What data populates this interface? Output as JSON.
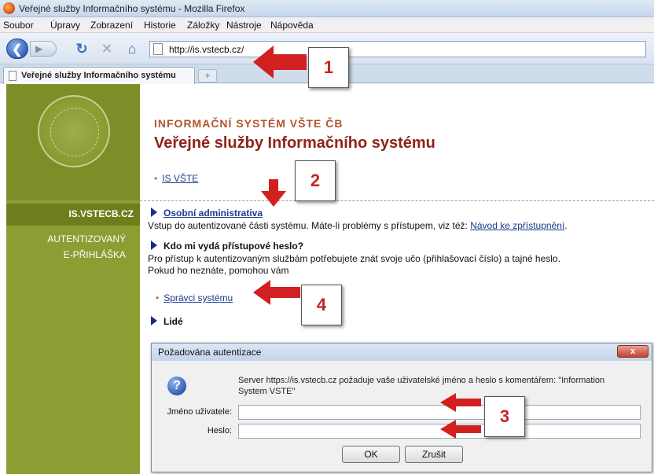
{
  "window": {
    "title": "Veřejné služby Informačního systému - Mozilla Firefox"
  },
  "menu": {
    "items": [
      "Soubor",
      "Úpravy",
      "Zobrazení",
      "Historie",
      "Záložky",
      "Nástroje",
      "Nápověda"
    ]
  },
  "toolbar": {
    "url": "http://is.vstecb.cz/"
  },
  "tabs": {
    "active_label": "Veřejné služby Informačního systému",
    "new_tab_label": "+"
  },
  "sidebar": {
    "active_item": "IS.VSTECB.CZ",
    "items": [
      "AUTENTIZOVANÝ",
      "E-PŘIHLÁŠKA"
    ]
  },
  "main": {
    "brand": "INFORMAČNÍ SYSTÉM VŠTE ČB",
    "heading": "Veřejné služby Informačního systému",
    "is_link": "IS VŠTE",
    "osobni": {
      "title": "Osobní administrativa",
      "text": "Vstup do autentizované části systému. Máte-li problémy s přístupem, viz též: ",
      "help_link": "Návod ke zpřístupnění",
      "help_suffix": "."
    },
    "heslo": {
      "title": "Kdo mi vydá přístupové heslo?",
      "line1": "Pro přístup k autentizovaným službám potřebujete znát svoje učo (přihlašovací číslo) a tajné heslo.",
      "line2": "Pokud ho neznáte, pomohou vám",
      "admins_link": "Správci systému"
    },
    "lide": {
      "title": "Lidé"
    }
  },
  "dialog": {
    "title": "Požadována autentizace",
    "close_label": "x",
    "message": "Server https://is.vstecb.cz požaduje vaše uživatelské jméno a heslo s komentářem: \"Information System VSTE\"",
    "username_label": "Jméno uživatele:",
    "password_label": "Heslo:",
    "ok_label": "OK",
    "cancel_label": "Zrušit"
  },
  "annotations": {
    "step1": "1",
    "step2": "2",
    "step3": "3",
    "step4": "4"
  },
  "colors": {
    "sidebar": "#8e9c34",
    "heading": "#8e2418",
    "link": "#1a3b8a",
    "annotation": "#d22020"
  }
}
